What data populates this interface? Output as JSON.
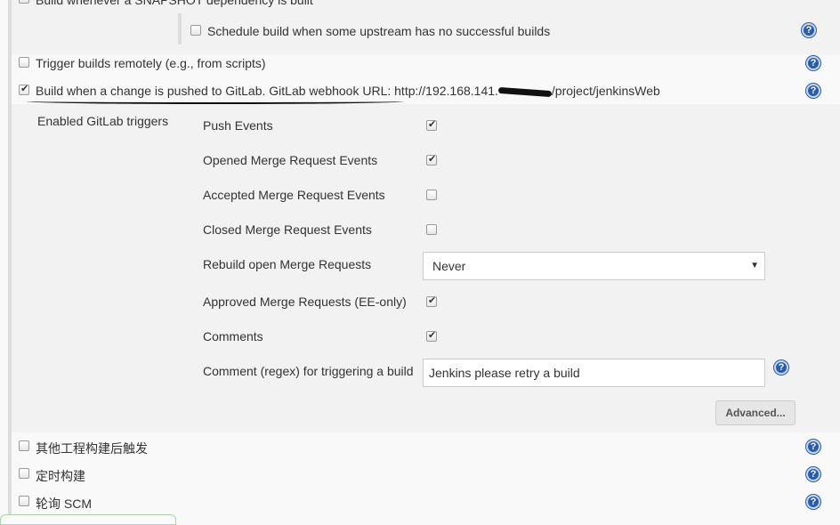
{
  "rows": {
    "snapshot": "Build whenever a SNAPSHOT dependency is built",
    "schedule_upstream": "Schedule build when some upstream has no successful builds",
    "trigger_remote": "Trigger builds remotely (e.g., from scripts)",
    "gitlab": "Build when a change is pushed to GitLab. GitLab webhook URL: http://192.168.141.",
    "gitlab_suffix": "/project/jenkinsWeb",
    "other_projects": "其他工程构建后触发",
    "periodic": "定时构建",
    "poll_scm": "轮询 SCM"
  },
  "gitlab": {
    "section_label": "Enabled GitLab triggers",
    "push_events": "Push Events",
    "opened_mr": "Opened Merge Request Events",
    "accepted_mr": "Accepted Merge Request Events",
    "closed_mr": "Closed Merge Request Events",
    "rebuild_label": "Rebuild open Merge Requests",
    "rebuild_value": "Never",
    "approved_mr": "Approved Merge Requests (EE-only)",
    "comments": "Comments",
    "comment_regex_label": "Comment (regex) for triggering a build",
    "comment_regex_value": "Jenkins please retry a build",
    "advanced": "Advanced..."
  },
  "checked": {
    "snapshot": false,
    "schedule_upstream": false,
    "trigger_remote": false,
    "gitlab": true,
    "push_events": true,
    "opened_mr": true,
    "accepted_mr": false,
    "closed_mr": false,
    "approved_mr": true,
    "comments": true,
    "other_projects": false,
    "periodic": false,
    "poll_scm": false
  },
  "icons": {
    "help": "help-icon",
    "checkbox": "checkbox"
  }
}
